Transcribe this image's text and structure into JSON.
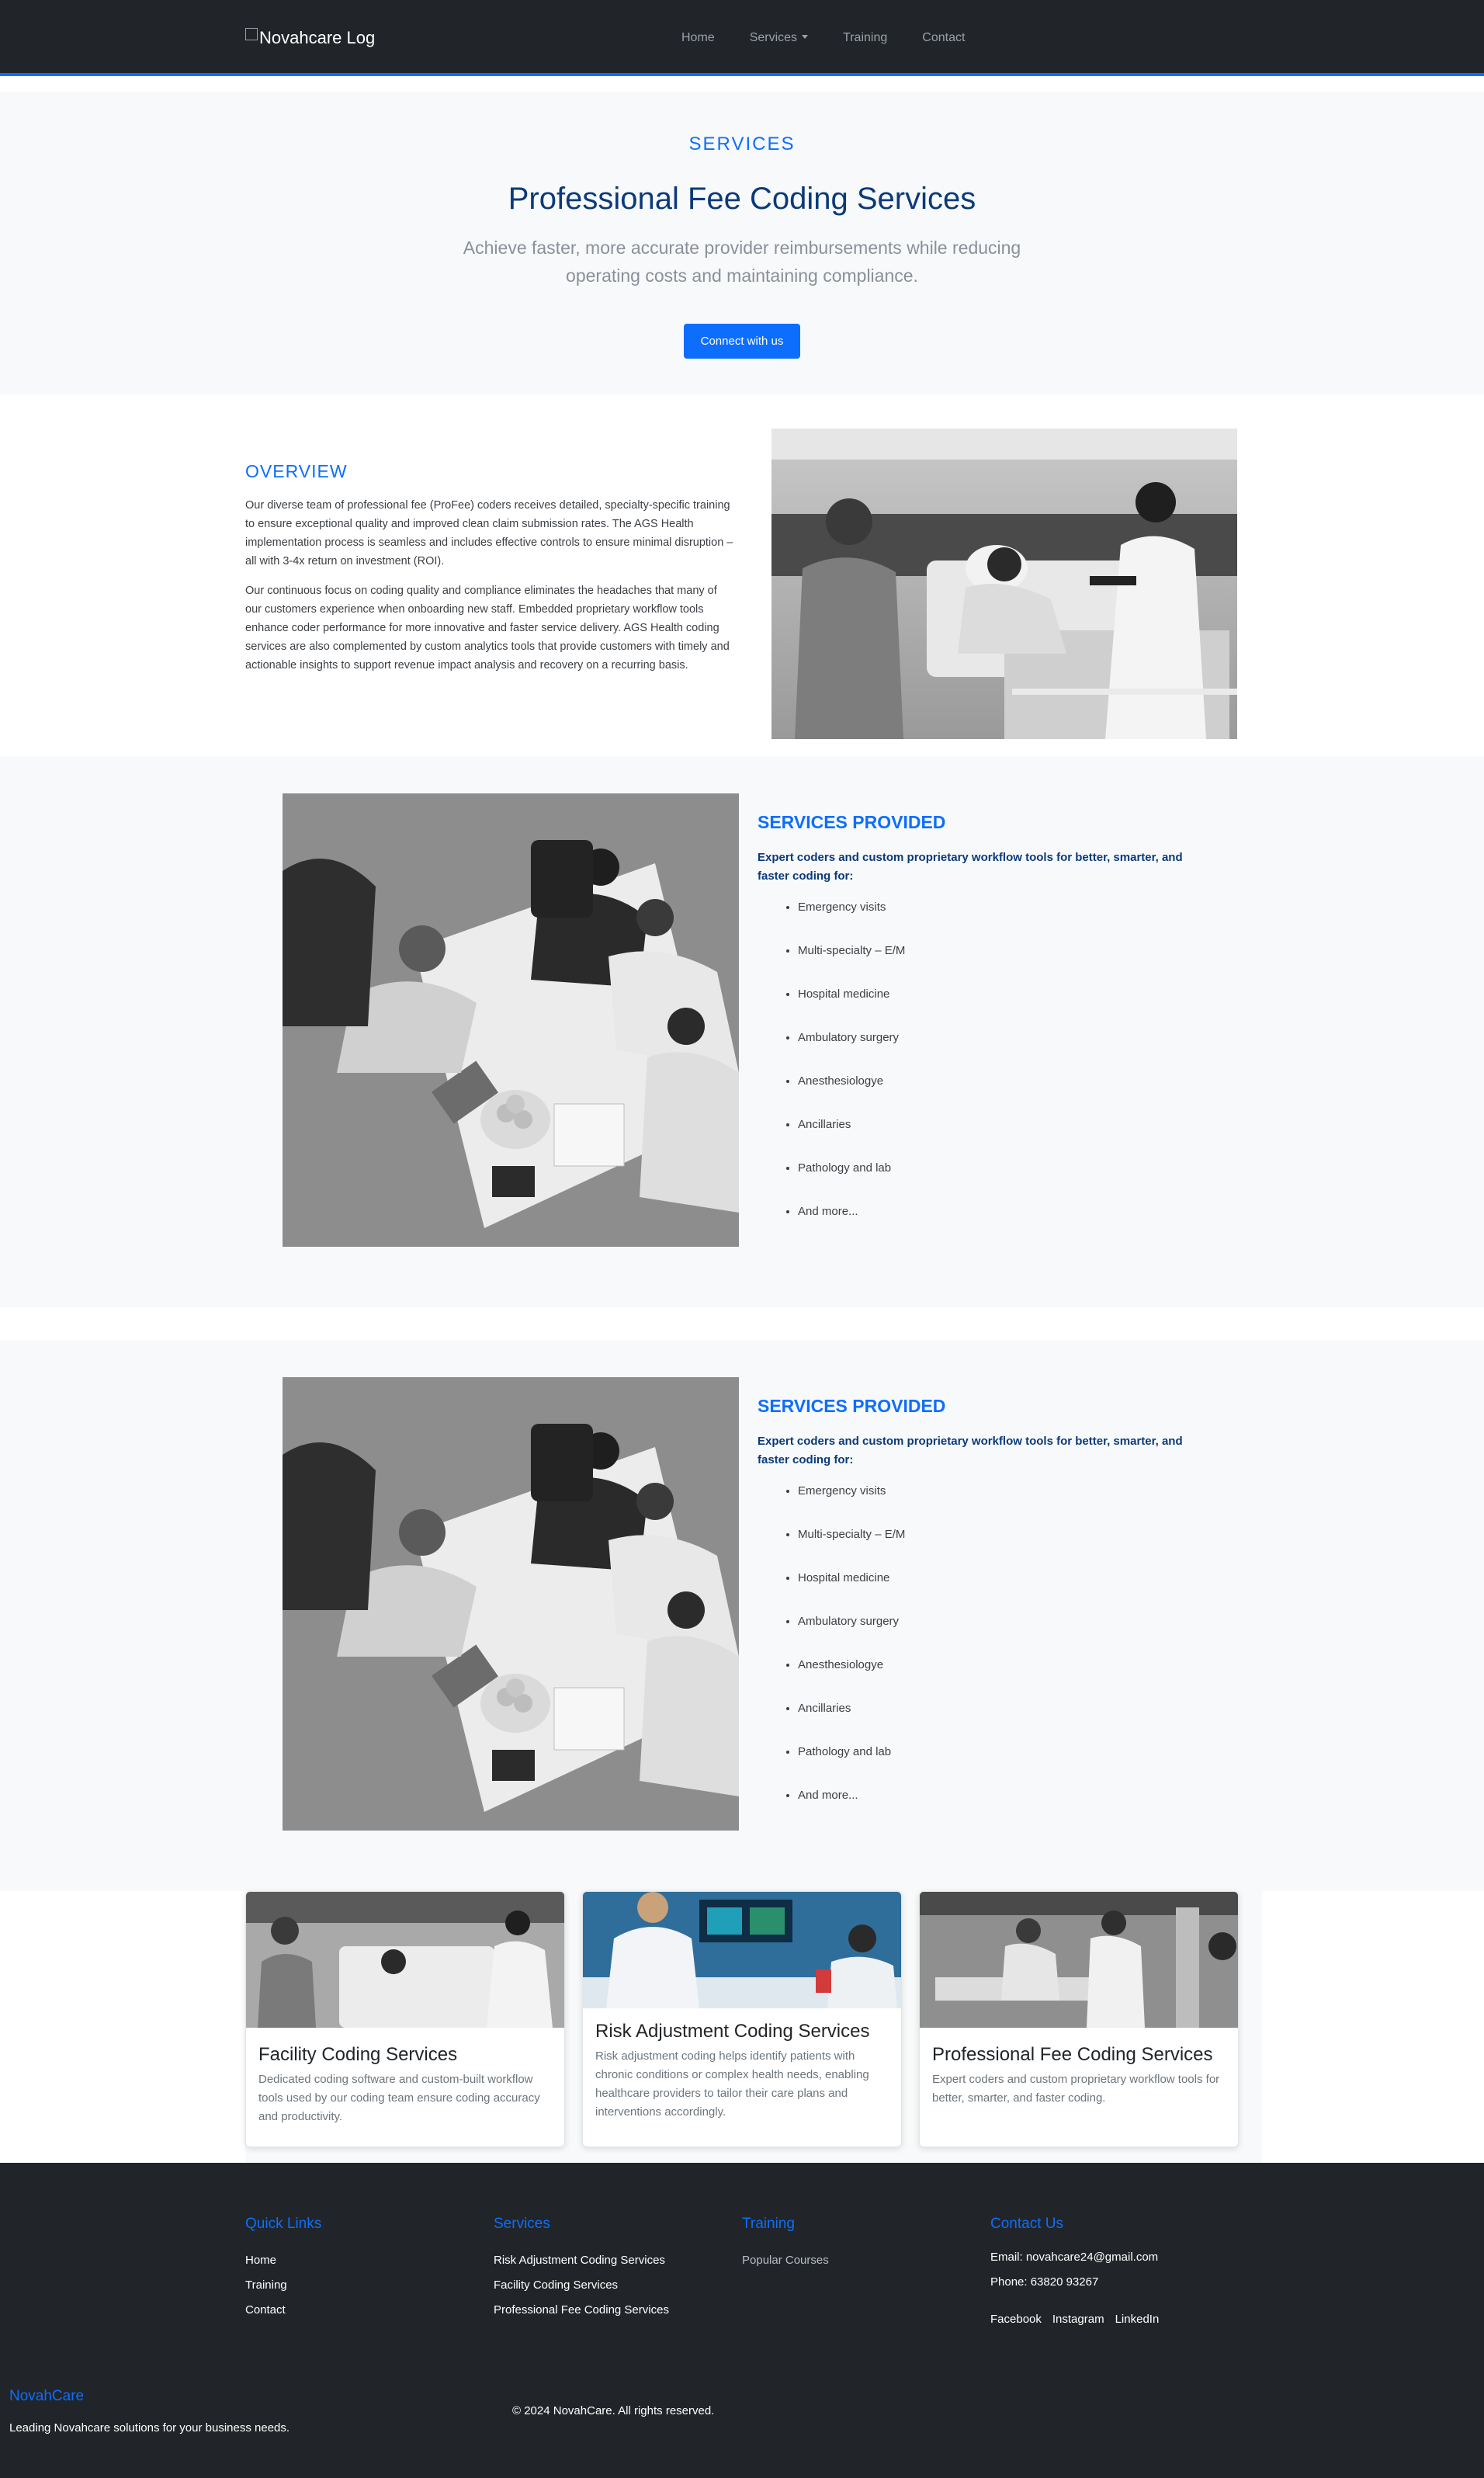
{
  "nav": {
    "logo_alt": "Novahcare Log",
    "links": [
      "Home",
      "Services",
      "Training",
      "Contact"
    ]
  },
  "hero": {
    "kicker": "SERVICES",
    "title": "Professional Fee Coding Services",
    "subtitle": "Achieve faster, more accurate provider reimbursements while reducing operating costs and maintaining compliance.",
    "button": "Connect with us"
  },
  "overview": {
    "title": "OVERVIEW",
    "p1": "Our diverse team of professional fee (ProFee) coders receives detailed, specialty-specific training to ensure exceptional quality and improved clean claim submission rates. The AGS Health implementation process is seamless and includes effective controls to ensure minimal disruption – all with 3-4x return on investment (ROI).",
    "p2": "Our continuous focus on coding quality and compliance eliminates the headaches that many of our customers experience when onboarding new staff. Embedded proprietary workflow tools enhance coder performance for more innovative and faster service delivery. AGS Health coding services are also complemented by custom analytics tools that provide customers with timely and actionable insights to support revenue impact analysis and recovery on a recurring basis."
  },
  "services": {
    "title": "SERVICES PROVIDED",
    "subtitle": "Expert coders and custom proprietary workflow tools for better, smarter, and faster coding for:",
    "items": [
      "Emergency visits",
      "Multi-specialty – E/M",
      "Hospital medicine",
      "Ambulatory surgery",
      "Anesthesiologye",
      "Ancillaries",
      "Pathology and lab",
      "And more..."
    ]
  },
  "cards": [
    {
      "title": "Facility Coding Services",
      "text": "Dedicated coding software and custom-built workflow tools used by our coding team ensure coding accuracy and productivity."
    },
    {
      "title": "Risk Adjustment Coding Services",
      "text": "Risk adjustment coding helps identify patients with chronic conditions or complex health needs, enabling healthcare providers to tailor their care plans and interventions accordingly."
    },
    {
      "title": "Professional Fee Coding Services",
      "text": "Expert coders and custom proprietary workflow tools for better, smarter, and faster coding."
    }
  ],
  "footer": {
    "quick_title": "Quick Links",
    "quick_links": [
      "Home",
      "Training",
      "Contact"
    ],
    "services_title": "Services",
    "services_links": [
      "Risk Adjustment Coding Services",
      "Facility Coding Services",
      "Professional Fee Coding Services"
    ],
    "training_title": "Training",
    "training_links": [
      "Popular Courses"
    ],
    "contact_title": "Contact Us",
    "email": "Email: novahcare24@gmail.com",
    "phone": "Phone: 63820 93267",
    "social": [
      "Facebook",
      "Instagram",
      "LinkedIn"
    ],
    "brand": "NovahCare",
    "tagline": "Leading Novahcare solutions for your business needs.",
    "copyright": "© 2024 NovahCare. All rights reserved."
  }
}
